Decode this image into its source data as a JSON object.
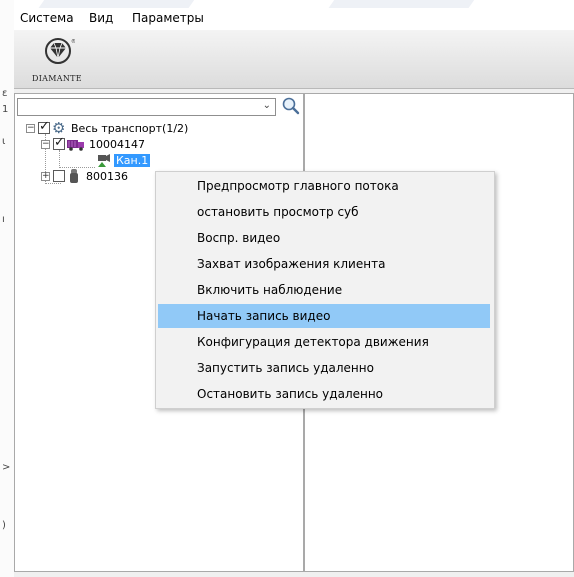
{
  "menubar": {
    "items": [
      "Система",
      "Вид",
      "Параметры"
    ]
  },
  "logo": {
    "text": "DIAMANTE",
    "registered": "®"
  },
  "search": {
    "value": ""
  },
  "tree": {
    "root": {
      "label": "Весь транспорт(1/2)",
      "checked": true,
      "expanded": true
    },
    "vehicle1": {
      "label": "10004147",
      "checked": true,
      "expanded": true
    },
    "channel1": {
      "label": "Кан.1",
      "selected": true
    },
    "vehicle2": {
      "label": "800136",
      "checked": false,
      "expanded": false
    }
  },
  "context_menu": {
    "items": [
      "Предпросмотр главного потока",
      "остановить просмотр суб",
      "Воспр. видео",
      "Захват изображения клиента",
      "Включить наблюдение",
      "Начать запись видео",
      "Конфигурация детектора движения",
      "Запустить запись удаленно",
      "Остановить запись удаленно"
    ],
    "highlighted_label": "Начать запись видео"
  },
  "colors": {
    "selection": "#3399ff",
    "menu_highlight": "#91c9f7",
    "vehicle_icon": "#7b2a8c",
    "channel_icon": "#3a9a3a"
  },
  "left_edge_marks": [
    "ε",
    "1",
    "ι",
    "ı",
    ">",
    ")"
  ]
}
